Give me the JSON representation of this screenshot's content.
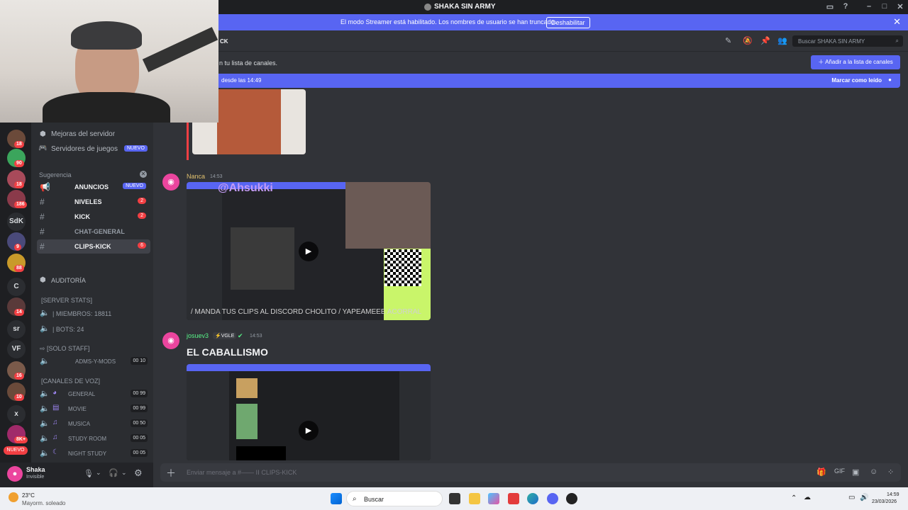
{
  "titlebar": {
    "title": "SHAKA SIN ARMY"
  },
  "streamer": {
    "message": "El modo Streamer está habilitado. Los nombres de usuario se han truncado.",
    "disable": "Deshabilitar"
  },
  "topbar": {
    "channel_fragment": "CK",
    "search_placeholder": "Buscar SHAKA SIN ARMY"
  },
  "notice": {
    "text": "n tu lista de canales.",
    "add_button": "Añadir a la lista de canales"
  },
  "newbar": {
    "text": "desde las 14:49",
    "mark_read": "Marcar como leído"
  },
  "servers": [
    {
      "label": "",
      "count": "18"
    },
    {
      "label": "",
      "count": "90"
    },
    {
      "label": "",
      "count": "18"
    },
    {
      "label": "",
      "count": "186"
    },
    {
      "label": "SdK",
      "count": ""
    },
    {
      "label": "",
      "count": "9"
    },
    {
      "label": "",
      "count": "88"
    },
    {
      "label": "C",
      "count": ""
    },
    {
      "label": "",
      "count": "14"
    },
    {
      "label": "sr",
      "count": ""
    },
    {
      "label": "VF",
      "count": ""
    },
    {
      "label": "",
      "count": "16"
    },
    {
      "label": "",
      "count": "10"
    },
    {
      "label": "x",
      "count": ""
    },
    {
      "label": "",
      "count": "8K+"
    }
  ],
  "server_new": "NUEVO",
  "sidebar": {
    "menu": [
      {
        "label": "Mejoras del servidor"
      },
      {
        "label": "Servidores de juegos",
        "badge": "NUEVO"
      }
    ],
    "suggest_category": "Sugerencia",
    "channels": [
      {
        "label": "ANUNCIOS",
        "badge": "NUEVO"
      },
      {
        "label": "NIVELES",
        "badge": "2"
      },
      {
        "label": "KICK",
        "badge": "2"
      },
      {
        "label": "CHAT-GENERAL",
        "badge": ""
      },
      {
        "label": "CLIPS-KICK",
        "badge": "6"
      }
    ],
    "audit": "Auditoría",
    "server_stats": "[SERVER STATS]",
    "stats": [
      {
        "label": "| MIEMBROS: 18811"
      },
      {
        "label": "| BOTS: 24"
      }
    ],
    "solo_staff": "[SOLO STAFF]",
    "staff_channels": [
      {
        "label": "ADMS-Y-MODS",
        "c1": "00",
        "c2": "10"
      }
    ],
    "voice_category": "[CANALES DE VOZ]",
    "voice": [
      {
        "label": "GENERAL",
        "c1": "00",
        "c2": "99"
      },
      {
        "label": "MOVIE",
        "c1": "00",
        "c2": "99"
      },
      {
        "label": "MUSICA",
        "c1": "00",
        "c2": "50"
      },
      {
        "label": "STUDY ROOM",
        "c1": "00",
        "c2": "05"
      },
      {
        "label": "NIGHT STUDY",
        "c1": "00",
        "c2": "05"
      }
    ]
  },
  "user": {
    "name": "Shaka",
    "status": "Invisible"
  },
  "messages": [
    {
      "author": "Nanca",
      "time": "14:53",
      "author_color": "#e1c16e",
      "overlay_text": "@Ahsukki",
      "caption": "/ MANDA TUS CLIPS AL DISCORD CHOLITO / YAPEAMEEE ACORRAL"
    },
    {
      "author": "josuev3",
      "tag": "VGLE",
      "time": "14:53",
      "author_color": "#57f287",
      "content": "EL CABALLISMO"
    }
  ],
  "composer": {
    "placeholder": "Enviar mensaje a #——  ꓲꓲ CLIPS-KICK"
  },
  "taskbar": {
    "weather_temp": "23°C",
    "weather_desc": "Mayorm. soleado",
    "search": "Buscar",
    "time": "14:59",
    "date": "23/03/2026"
  }
}
